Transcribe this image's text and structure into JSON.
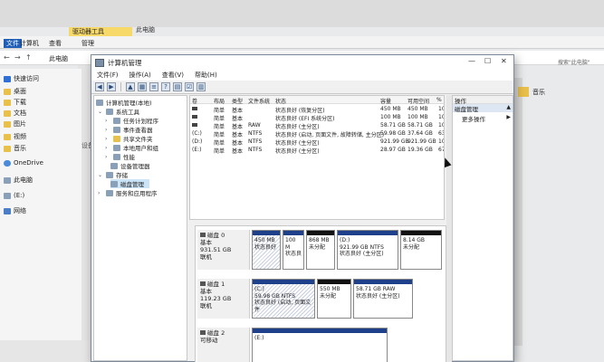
{
  "explorer": {
    "ribbon_tools_tab": "驱动器工具",
    "tab_this_pc": "此电脑",
    "ribbon_file": "文件",
    "ribbon_computer": "计算机",
    "ribbon_view": "查看",
    "ribbon_manage": "管理",
    "address": "此电脑",
    "search_placeholder": "搜索\"此电脑\"",
    "nav_items": [
      {
        "label": "快速访问",
        "icon": "star-icon"
      },
      {
        "label": "桌面",
        "icon": "folder-icon"
      },
      {
        "label": "下载",
        "icon": "download-icon"
      },
      {
        "label": "文档",
        "icon": "document-icon"
      },
      {
        "label": "图片",
        "icon": "picture-icon"
      },
      {
        "label": "视频",
        "icon": "video-icon"
      },
      {
        "label": "音乐",
        "icon": "music-icon"
      },
      {
        "label": "OneDrive",
        "icon": "cloud-icon"
      },
      {
        "label": "此电脑",
        "icon": "computer-icon"
      },
      {
        "label": "(E:)",
        "icon": "drive-icon"
      },
      {
        "label": "网络",
        "icon": "network-icon"
      }
    ],
    "section_devices": "设备",
    "right_folder": "音乐"
  },
  "cm": {
    "title": "计算机管理",
    "menu": [
      "文件(F)",
      "操作(A)",
      "查看(V)",
      "帮助(H)"
    ],
    "tree": {
      "root": "计算机管理(本地)",
      "system_tools": "系统工具",
      "task_scheduler": "任务计划程序",
      "event_viewer": "事件查看器",
      "shared_folders": "共享文件夹",
      "local_users": "本地用户和组",
      "performance": "性能",
      "device_manager": "设备管理器",
      "storage": "存储",
      "disk_management": "磁盘管理",
      "services": "服务和应用程序"
    },
    "columns": [
      "卷",
      "布局",
      "类型",
      "文件系统",
      "状态",
      "容量",
      "可用空间",
      "%"
    ],
    "volumes": [
      {
        "vol": "",
        "layout": "简单",
        "type": "基本",
        "fs": "",
        "status": "状态良好 (恢复分区)",
        "cap": "450 MB",
        "free": "450 MB",
        "pct": "10"
      },
      {
        "vol": "",
        "layout": "简单",
        "type": "基本",
        "fs": "",
        "status": "状态良好 (EFI 系统分区)",
        "cap": "100 MB",
        "free": "100 MB",
        "pct": "10"
      },
      {
        "vol": "",
        "layout": "简单",
        "type": "基本",
        "fs": "RAW",
        "status": "状态良好 (主分区)",
        "cap": "58.71 GB",
        "free": "58.71 GB",
        "pct": "10"
      },
      {
        "vol": "(C:)",
        "layout": "简单",
        "type": "基本",
        "fs": "NTFS",
        "status": "状态良好 (启动, 页面文件, 故障转储, 主分区)",
        "cap": "59.98 GB",
        "free": "37.64 GB",
        "pct": "63"
      },
      {
        "vol": "(D:)",
        "layout": "简单",
        "type": "基本",
        "fs": "NTFS",
        "status": "状态良好 (主分区)",
        "cap": "921.99 GB",
        "free": "921.99 GB",
        "pct": "10"
      },
      {
        "vol": "(E:)",
        "layout": "简单",
        "type": "基本",
        "fs": "NTFS",
        "status": "状态良好 (主分区)",
        "cap": "28.97 GB",
        "free": "19.36 GB",
        "pct": "67"
      }
    ],
    "disks": [
      {
        "name": "磁盘 0",
        "type": "基本",
        "size": "931.51 GB",
        "state": "联机",
        "parts": [
          {
            "l1": "450 MB",
            "l2": "状态良好",
            "l3": ""
          },
          {
            "l1": "100 M",
            "l2": "状态良",
            "l3": ""
          },
          {
            "l1": "868 MB",
            "l2": "未分配",
            "l3": ""
          },
          {
            "l1": "(D:)",
            "l2": "921.99 GB NTFS",
            "l3": "状态良好 (主分区)"
          },
          {
            "l1": "8.14 GB",
            "l2": "未分配",
            "l3": ""
          }
        ]
      },
      {
        "name": "磁盘 1",
        "type": "基本",
        "size": "119.23 GB",
        "state": "联机",
        "parts": [
          {
            "l1": "(C:)",
            "l2": "59.98 GB NTFS",
            "l3": "状态良好 (启动, 页面文件"
          },
          {
            "l1": "550 MB",
            "l2": "未分配",
            "l3": ""
          },
          {
            "l1": "58.71 GB RAW",
            "l2": "状态良好 (主分区)",
            "l3": ""
          }
        ]
      },
      {
        "name": "磁盘 2",
        "type": "可移动",
        "size": "",
        "state": "",
        "parts": [
          {
            "l1": "(E:)",
            "l2": "",
            "l3": ""
          }
        ]
      }
    ],
    "actions": {
      "header": "操作",
      "section": "磁盘管理",
      "more": "更多操作"
    }
  }
}
